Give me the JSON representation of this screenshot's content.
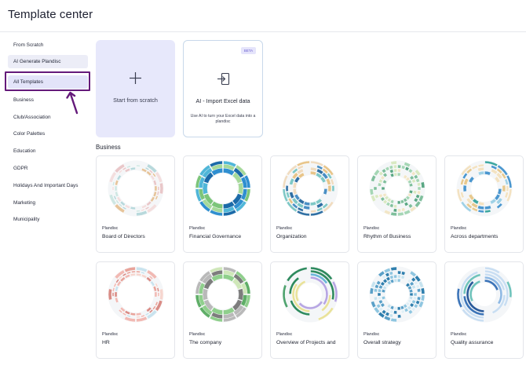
{
  "header": {
    "title": "Template center"
  },
  "sidebar": {
    "items": [
      {
        "label": "From Scratch",
        "name": "sidebar-item-from-scratch"
      },
      {
        "label": "AI Generate Plandisc",
        "name": "sidebar-item-ai-generate"
      },
      {
        "label": "All Templates",
        "name": "sidebar-item-all-templates"
      },
      {
        "label": "Business",
        "name": "sidebar-item-business"
      },
      {
        "label": "Club/Association",
        "name": "sidebar-item-club-association"
      },
      {
        "label": "Color Palettes",
        "name": "sidebar-item-color-palettes"
      },
      {
        "label": "Education",
        "name": "sidebar-item-education"
      },
      {
        "label": "GDPR",
        "name": "sidebar-item-gdpr"
      },
      {
        "label": "Holidays And Important Days",
        "name": "sidebar-item-holidays"
      },
      {
        "label": "Marketing",
        "name": "sidebar-item-marketing"
      },
      {
        "label": "Municipality",
        "name": "sidebar-item-municipality"
      }
    ],
    "active_index": 2
  },
  "start_cards": {
    "scratch": {
      "label": "Start from scratch",
      "icon": "plus-icon"
    },
    "excel": {
      "badge": "BETA",
      "label": "AI - Import Excel data",
      "description": "Use AI to turn your Excel data into a plandisc",
      "icon": "import-icon"
    }
  },
  "section": {
    "title": "Business"
  },
  "templates": [
    {
      "kind": "Plandisc",
      "name": "Board of Directors",
      "palette": [
        "#e9c7c9",
        "#cfe7e3",
        "#e6c49a",
        "#b8d9dc",
        "#f3dede"
      ],
      "style": "thin"
    },
    {
      "kind": "Plandisc",
      "name": "Financial Governance",
      "palette": [
        "#2f8fd0",
        "#7cc57a",
        "#4fb6d8",
        "#a6d99a",
        "#1b6aa8"
      ],
      "style": "bold"
    },
    {
      "kind": "Plandisc",
      "name": "Organization",
      "palette": [
        "#4a8fc4",
        "#e8c58a",
        "#7ec8c6",
        "#f0dcc0",
        "#2f6fa3"
      ],
      "style": "mixed"
    },
    {
      "kind": "Plandisc",
      "name": "Rhythm of Business",
      "palette": [
        "#a5d6b5",
        "#d9e9c2",
        "#7fbf9c",
        "#f2e6c7",
        "#5aa784"
      ],
      "style": "dense"
    },
    {
      "kind": "Plandisc",
      "name": "Across departments",
      "palette": [
        "#4b97cf",
        "#e7c98f",
        "#9fd1e6",
        "#f3e2c1",
        "#3ea7a0"
      ],
      "style": "mixed"
    },
    {
      "kind": "Plandisc",
      "name": "HR",
      "palette": [
        "#f1b9b3",
        "#e8a39a",
        "#f6d6cf",
        "#d98c86",
        "#c9e3ee"
      ],
      "style": "thin"
    },
    {
      "kind": "Plandisc",
      "name": "The company",
      "palette": [
        "#8fcf8c",
        "#5fae67",
        "#b9b9b9",
        "#cfe7b9",
        "#7d7d7d"
      ],
      "style": "bold"
    },
    {
      "kind": "Plandisc",
      "name": "Overview of Projects and",
      "palette": [
        "#2e8a5e",
        "#b7a6e3",
        "#6db6d8",
        "#e9e29a",
        "#4fa36f"
      ],
      "style": "rings"
    },
    {
      "kind": "Plandisc",
      "name": "Overall strategy",
      "palette": [
        "#8fc6e0",
        "#5aa0c8",
        "#c6e3ef",
        "#2f7fae",
        "#e0eff6"
      ],
      "style": "dense"
    },
    {
      "kind": "Plandisc",
      "name": "Quality assurance",
      "palette": [
        "#3c74b8",
        "#8fb9e4",
        "#6fc3bb",
        "#2a5a9a",
        "#c9def2"
      ],
      "style": "rings"
    }
  ]
}
